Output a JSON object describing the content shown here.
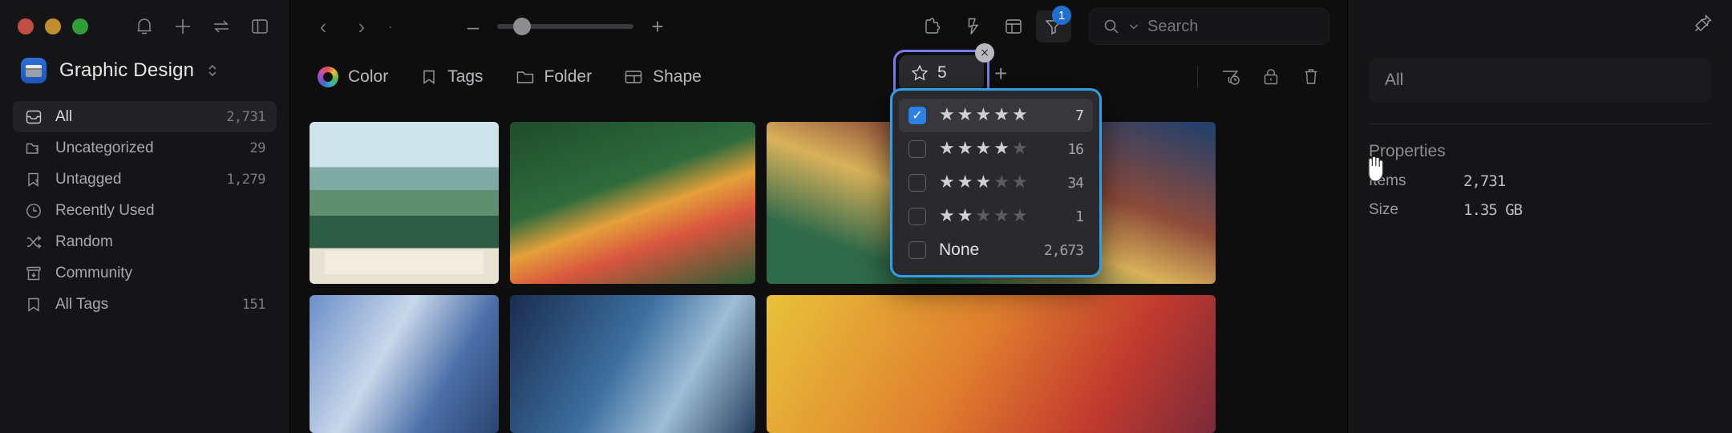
{
  "window": {
    "traffic_lights": [
      "close",
      "minimize",
      "maximize"
    ],
    "sidebar_icons": [
      "bell-icon",
      "plus-icon",
      "sync-icon",
      "panel-toggle-icon"
    ]
  },
  "sidebar": {
    "library": {
      "name": "Graphic Design",
      "icon": "library-icon"
    },
    "items": [
      {
        "label": "All",
        "count": "2,731",
        "icon": "inbox-icon",
        "active": true
      },
      {
        "label": "Uncategorized",
        "count": "29",
        "icon": "folder-question-icon",
        "active": false
      },
      {
        "label": "Untagged",
        "count": "1,279",
        "icon": "tag-question-icon",
        "active": false
      },
      {
        "label": "Recently Used",
        "count": "",
        "icon": "clock-icon",
        "active": false
      },
      {
        "label": "Random",
        "count": "",
        "icon": "shuffle-icon",
        "active": false
      },
      {
        "label": "Community",
        "count": "",
        "icon": "community-icon",
        "active": false
      },
      {
        "label": "All Tags",
        "count": "151",
        "icon": "bookmark-icon",
        "active": false
      }
    ]
  },
  "toolbar": {
    "back_label": "‹",
    "forward_label": "›",
    "breadcrumb_dot": "·",
    "zoom_out_label": "–",
    "zoom_in_label": "+",
    "icons": [
      "extension-icon",
      "lightning-icon",
      "layout-icon",
      "filter-icon"
    ],
    "filter_badge": "1",
    "search": {
      "placeholder": "Search",
      "value": "",
      "icon": "search-icon",
      "chevron": "chevron-down-icon"
    }
  },
  "filterbar": {
    "items": [
      {
        "label": "Color",
        "icon": "color-wheel-icon"
      },
      {
        "label": "Tags",
        "icon": "bookmark-icon"
      },
      {
        "label": "Folder",
        "icon": "folder-icon"
      },
      {
        "label": "Shape",
        "icon": "shape-icon"
      }
    ],
    "right_icons": [
      "filter-history-icon",
      "lock-icon",
      "trash-icon"
    ],
    "chip": {
      "label": "5",
      "icon": "star-outline-icon",
      "close": "×"
    },
    "add_filter_label": "+"
  },
  "rating_dropdown": {
    "rows": [
      {
        "stars": 5,
        "count": "7",
        "checked": true,
        "label": ""
      },
      {
        "stars": 4,
        "count": "16",
        "checked": false,
        "label": ""
      },
      {
        "stars": 3,
        "count": "34",
        "checked": false,
        "label": ""
      },
      {
        "stars": 2,
        "count": "1",
        "checked": false,
        "label": ""
      },
      {
        "stars": 0,
        "count": "2,673",
        "checked": false,
        "label": "None"
      }
    ],
    "star_glyph": "★",
    "max_stars": 5,
    "accent": "#2f9fe8",
    "check_color": "#2f7fe8"
  },
  "right_panel": {
    "pin_icon": "pin-icon",
    "scope": "All",
    "properties_title": "Properties",
    "properties": [
      {
        "label": "Items",
        "value": "2,731"
      },
      {
        "label": "Size",
        "value": "1.35 GB"
      }
    ]
  },
  "colors": {
    "accent_blue": "#2f7fe8",
    "dropdown_border": "#2f9fe8",
    "chip_border": "#7b7bf0",
    "bg": "#0e0e0f",
    "panel": "#151517"
  }
}
